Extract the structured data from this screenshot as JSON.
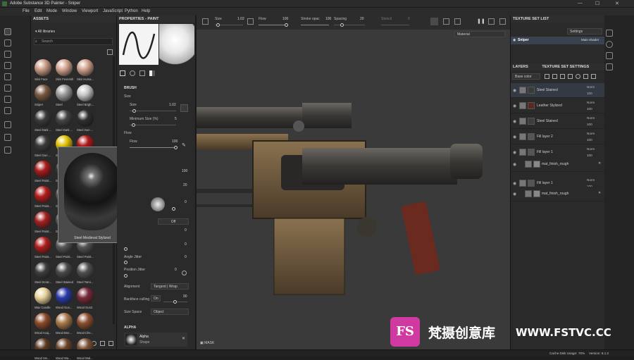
{
  "window": {
    "title": "Adobe Substance 3D Painter - Sniper",
    "controls": [
      "—",
      "☐",
      "✕"
    ]
  },
  "menu": [
    "File",
    "Edit",
    "Mode",
    "Window",
    "Viewport",
    "JavaScript",
    "Python",
    "Help"
  ],
  "assets": {
    "title": "ASSETS",
    "library": "All libraries",
    "search_placeholder": "Search",
    "items": [
      {
        "label": "Skin Face",
        "color": "#c89a84"
      },
      {
        "label": "Skin Feverish",
        "color": "#d3a28e"
      },
      {
        "label": "Skin Huma...",
        "color": "#cfa08a"
      },
      {
        "label": "Sniper",
        "color": "#7a5a44"
      },
      {
        "label": "Steel",
        "color": "#9a9a9a"
      },
      {
        "label": "Steel Brigh...",
        "color": "#c8c8c8"
      },
      {
        "label": "Steel Dark ...",
        "color": "#3a3a3a"
      },
      {
        "label": "Steel Dark ...",
        "color": "#444444"
      },
      {
        "label": "Steel Gun ...",
        "color": "#2f2f2f"
      },
      {
        "label": "Steel Gun ...",
        "color": "#3b3b3b"
      },
      {
        "label": "Steel Pain...",
        "color": "#e0c000"
      },
      {
        "label": "Steel Pain...",
        "color": "#b01818"
      },
      {
        "label": "Steel Paint...",
        "color": "#a81c1c"
      },
      {
        "label": "Steel Paint...",
        "color": "#3a3a3a"
      },
      {
        "label": "Steel Paint...",
        "color": "#444"
      },
      {
        "label": "Steel Paint...",
        "color": "#b51d1d"
      },
      {
        "label": "Steel Paint...",
        "color": "#555"
      },
      {
        "label": "Steel Paint...",
        "color": "#555"
      },
      {
        "label": "Steel Paint...",
        "color": "#a42020"
      },
      {
        "label": "Steel Paint...",
        "color": "#555"
      },
      {
        "label": "Steel Paint...",
        "color": "#555"
      },
      {
        "label": "Steel Paint...",
        "color": "#b01e1e"
      },
      {
        "label": "Steel Paint...",
        "color": "#555"
      },
      {
        "label": "Steel Paint...",
        "color": "#555"
      },
      {
        "label": "Steel Scrat...",
        "color": "#3d3d3d"
      },
      {
        "label": "Steel Stained",
        "color": "#4a4a4a"
      },
      {
        "label": "Steel Tarni...",
        "color": "#505050"
      },
      {
        "label": "Wax Candle",
        "color": "#e6d29a"
      },
      {
        "label": "Wood Gun...",
        "color": "#2a3aa8"
      },
      {
        "label": "Wood Gun2",
        "color": "#7a2a3a"
      },
      {
        "label": "Wood Acaj...",
        "color": "#8a4a2a"
      },
      {
        "label": "Wood Bee...",
        "color": "#a8784a"
      },
      {
        "label": "Wood Che...",
        "color": "#8a5030"
      },
      {
        "label": "Wood Sm...",
        "color": "#5a3a24"
      },
      {
        "label": "Wood Wa...",
        "color": "#6a4428"
      },
      {
        "label": "Wood Wal...",
        "color": "#7a5034"
      }
    ],
    "preview_label": "Steel Medieval Stylized"
  },
  "properties": {
    "title": "PROPERTIES - PAINT",
    "brush_section": "BRUSH",
    "size_group": "Size",
    "size_label": "Size",
    "size_value": "1.02",
    "min_size_label": "Minimum Size (%)",
    "min_size_value": "5",
    "flow_group": "Flow",
    "flow_label": "Flow",
    "flow_value": "100",
    "hidden_value1": "100",
    "hidden_value2": "20",
    "angle_value": "0",
    "off_label": "Off",
    "val_a": "0",
    "val_b": "0",
    "angle_jitter_label": "Angle Jitter",
    "angle_jitter_value": "0",
    "position_jitter_label": "Position Jitter",
    "position_jitter_value": "0",
    "alignment_label": "Alignment",
    "alignment_value": "Tangent | Wrap",
    "backface_label": "Backface culling",
    "backface_toggle": "On",
    "backface_value": "90",
    "size_space_label": "Size Space",
    "size_space_value": "Object",
    "alpha_section": "ALPHA",
    "alpha_name": "Alpha",
    "alpha_sub": "Shape"
  },
  "toolbar": {
    "size_label": "Size",
    "size_value": "1.02",
    "flow_label": "Flow",
    "flow_value": "100",
    "stroke_label": "Stroke opac",
    "stroke_value": "100",
    "spacing_label": "Spacing",
    "spacing_value": "20",
    "stencil_label": "Stencil",
    "stencil_value": "0",
    "material_dropdown": "Material"
  },
  "viewport": {
    "mask_label": "MASK"
  },
  "texture_set_list": {
    "title": "TEXTURE SET LIST",
    "settings": "Settings",
    "set_name": "Sniper",
    "shader": "Main shader"
  },
  "layers_panel": {
    "tab_layers": "LAYERS",
    "tab_tss": "TEXTURE SET SETTINGS",
    "channel": "Base color",
    "layers": [
      {
        "name": "Steel Stained",
        "blend": "Norm",
        "opacity": "100",
        "swatch": "#3a3a3a"
      },
      {
        "name": "Leather Stylized",
        "blend": "Norm",
        "opacity": "100",
        "swatch": "#5a2a22"
      },
      {
        "name": "Steel Stained",
        "blend": "Norm",
        "opacity": "100",
        "swatch": "#3d3d3d"
      },
      {
        "name": "Fill layer 2",
        "blend": "Norm",
        "opacity": "100",
        "swatch": "#555"
      },
      {
        "name": "Fill layer 1",
        "blend": "Norm",
        "opacity": "100",
        "swatch": "#555"
      },
      {
        "name": "mat_finish_rough",
        "blend": "",
        "opacity": "",
        "swatch": "#888"
      },
      {
        "name": "Fill layer 1",
        "blend": "Norm",
        "opacity": "100",
        "swatch": "#555"
      },
      {
        "name": "mat_finish_rough",
        "blend": "",
        "opacity": "",
        "swatch": "#888"
      }
    ]
  },
  "status": {
    "cache": "Cache Disk Usage:",
    "cache_value": "70%",
    "version": "Version: 8.1.2"
  },
  "watermark": {
    "logo": "FS",
    "text": "梵摄创意库",
    "url": "WWW.FSTVC.CC"
  }
}
